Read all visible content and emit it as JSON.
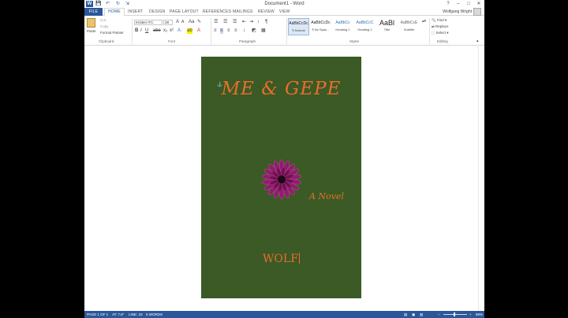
{
  "window": {
    "title": "Document1 - Word",
    "app_icon": "W",
    "controls": [
      "?",
      "–",
      "□",
      "✕"
    ]
  },
  "quick_access": {
    "save_icon": "💾",
    "undo_icon": "↶",
    "redo_icon": "↻",
    "more_icon": "⇲"
  },
  "tabs": [
    "FILE",
    "HOME",
    "INSERT",
    "DESIGN",
    "PAGE LAYOUT",
    "REFERENCES",
    "MAILINGS",
    "REVIEW",
    "VIEW"
  ],
  "user": "Wolfgang Wright",
  "ribbon": {
    "clipboard": {
      "paste": "Paste",
      "cut": "Cut",
      "copy": "Copy",
      "format_painter": "Format Painter",
      "label": "Clipboard"
    },
    "font": {
      "name": "Kristen ITC",
      "size": "28",
      "label": "Font"
    },
    "paragraph": {
      "label": "Paragraph"
    },
    "styles": {
      "label": "Styles",
      "items": [
        {
          "sample": "AaBbCcDc",
          "name": "¶ Normal"
        },
        {
          "sample": "AaBbCcDc",
          "name": "¶ No Spac..."
        },
        {
          "sample": "AaBbCc",
          "name": "Heading 1"
        },
        {
          "sample": "AaBbCcC",
          "name": "Heading 2"
        },
        {
          "sample": "AaBl",
          "name": "Title"
        },
        {
          "sample": "AaBbCcE",
          "name": "Subtitle"
        }
      ]
    },
    "editing": {
      "find": "Find",
      "replace": "Replace",
      "select": "Select",
      "label": "Editing"
    }
  },
  "document": {
    "title": "ME & GEPE",
    "subtitle": "A Novel",
    "author": "WOLF"
  },
  "status": {
    "page": "PAGE 1 OF 1",
    "at": "AT: 7.6\"",
    "line": "LINE: 10",
    "words": "5 WORDS",
    "zoom": "88%"
  },
  "colors": {
    "brand": "#2b579a",
    "page_bg": "#3b5a25",
    "cover_text": "#e86e2c",
    "flower": "#8a1f6d"
  }
}
